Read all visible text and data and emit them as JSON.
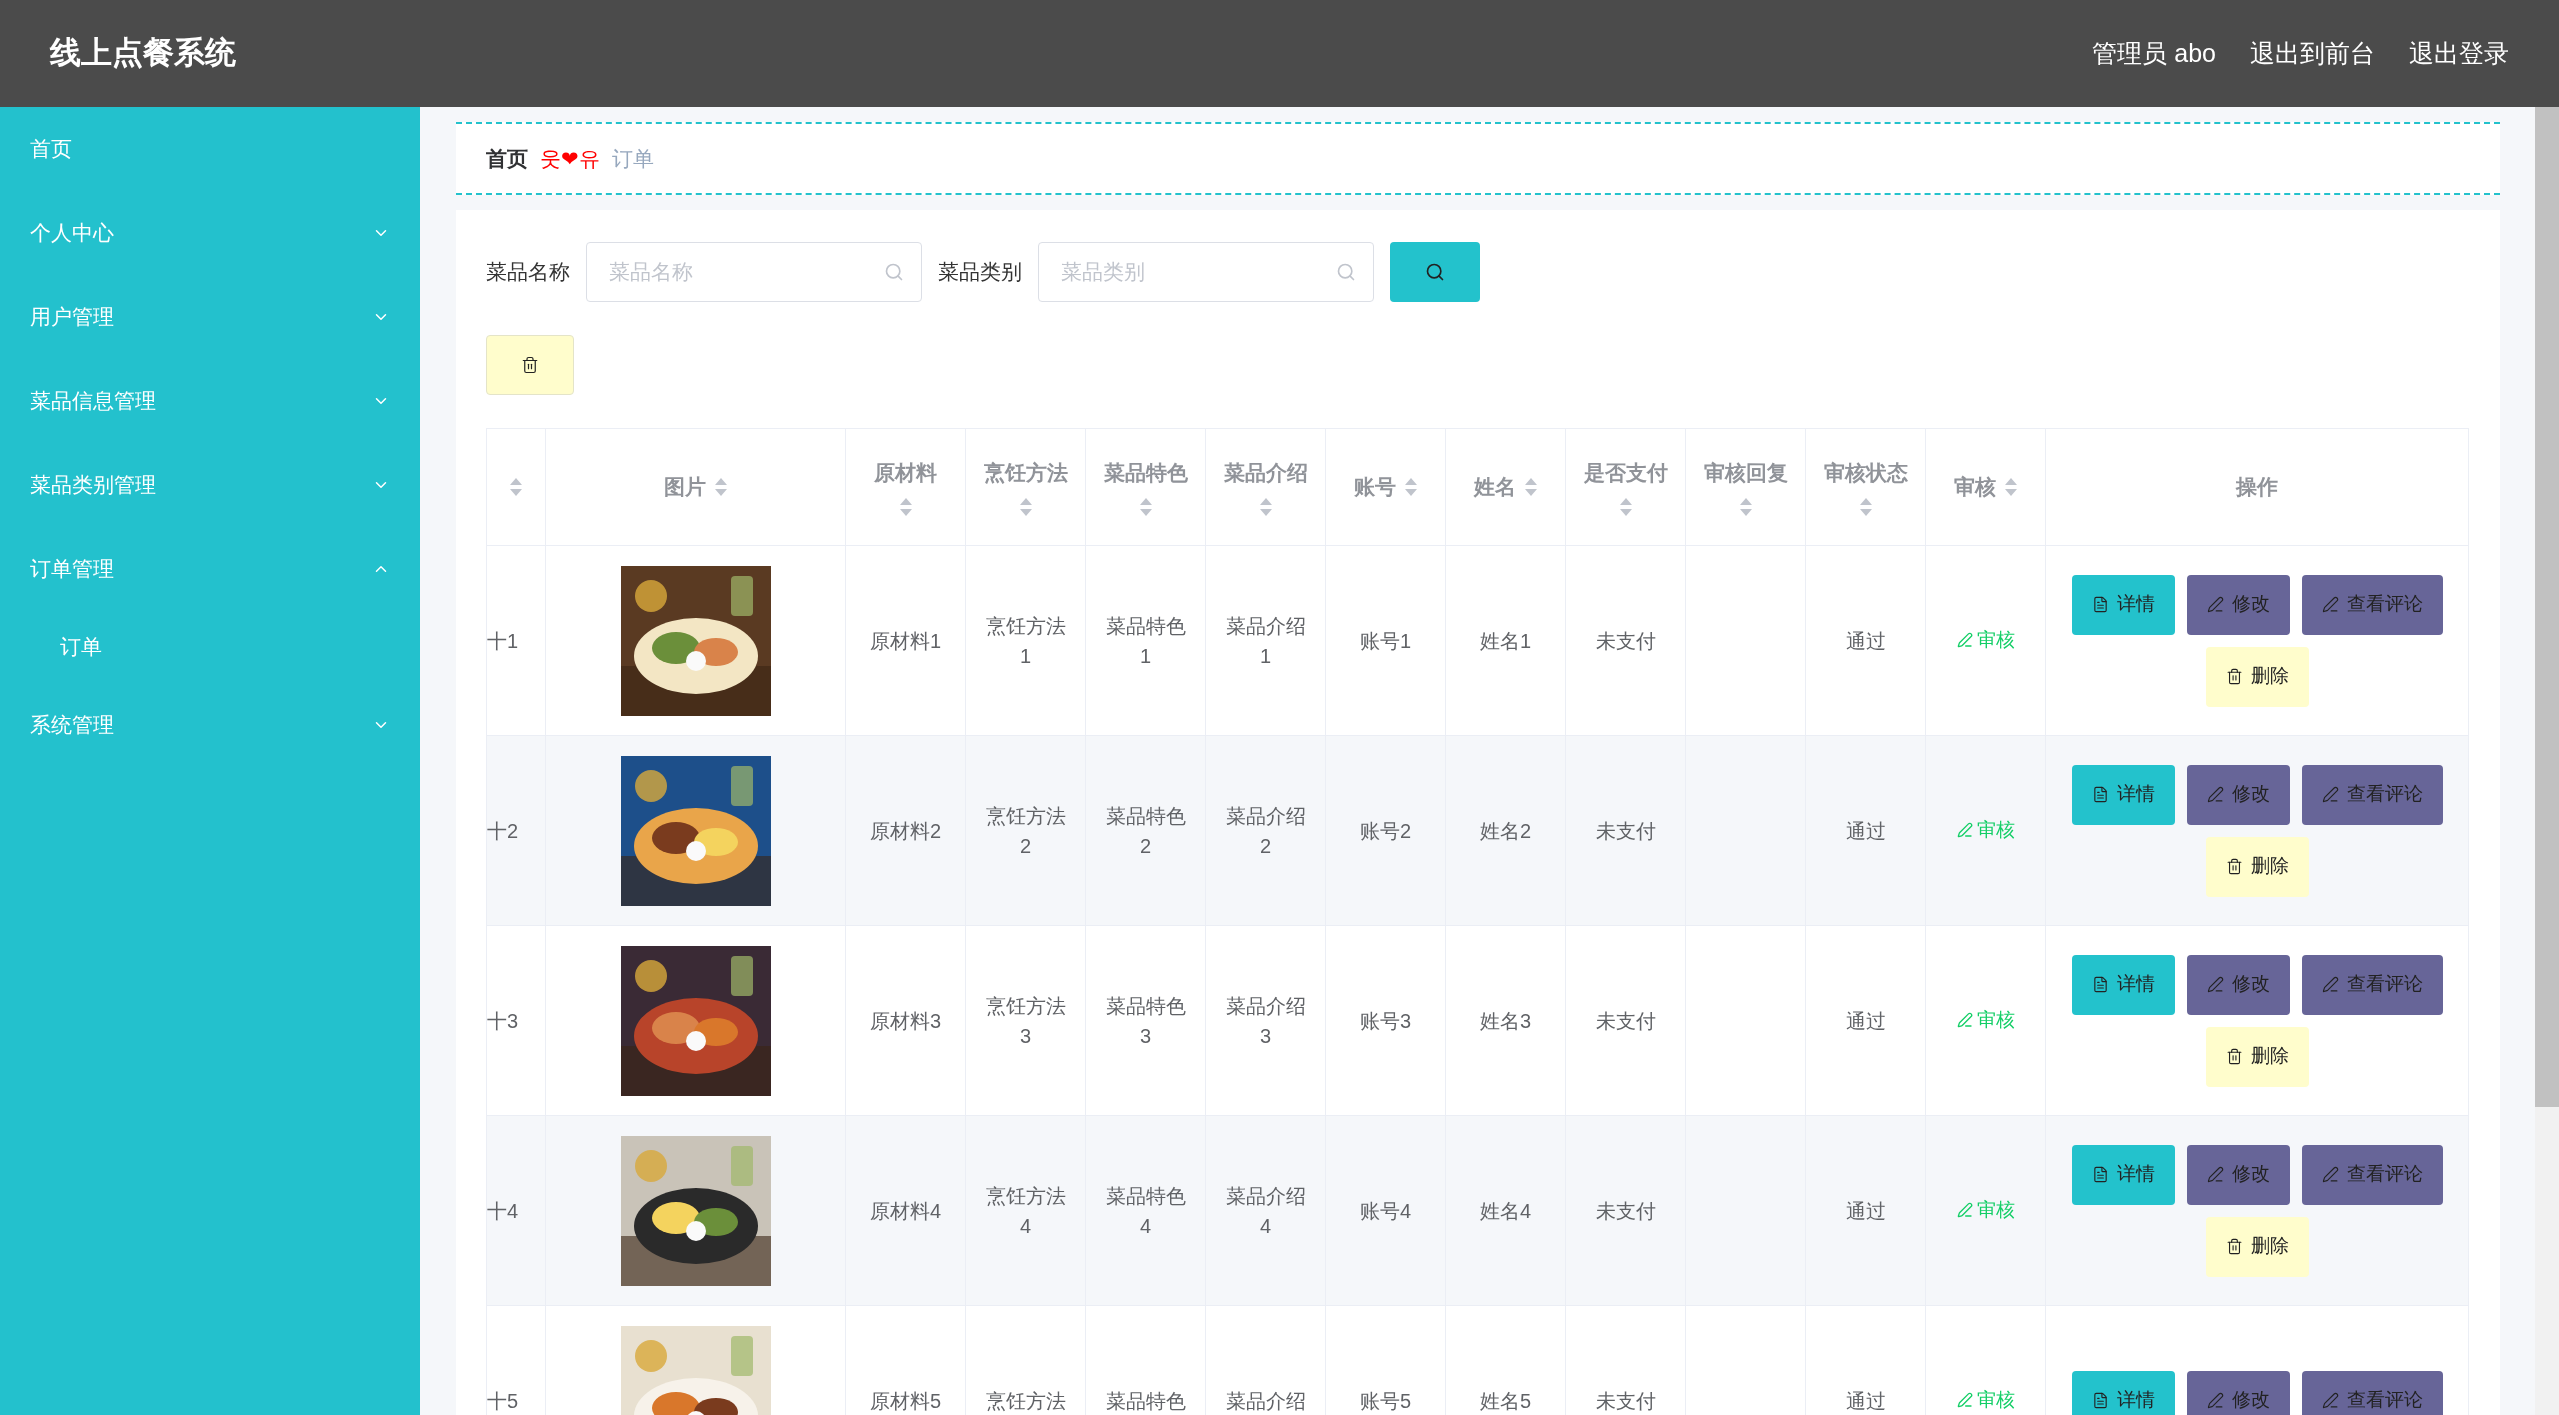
{
  "header": {
    "title": "线上点餐系统",
    "links": [
      "管理员 abo",
      "退出到前台",
      "退出登录"
    ]
  },
  "sidebar": {
    "items": [
      {
        "label": "首页",
        "kind": "link"
      },
      {
        "label": "个人中心",
        "kind": "menu",
        "expanded": false
      },
      {
        "label": "用户管理",
        "kind": "menu",
        "expanded": false
      },
      {
        "label": "菜品信息管理",
        "kind": "menu",
        "expanded": false
      },
      {
        "label": "菜品类别管理",
        "kind": "menu",
        "expanded": false
      },
      {
        "label": "订单管理",
        "kind": "menu",
        "expanded": true,
        "children": [
          {
            "label": "订单"
          }
        ]
      },
      {
        "label": "系统管理",
        "kind": "menu",
        "expanded": false
      }
    ]
  },
  "breadcrumb": {
    "home": "首页",
    "separator": "웃❤유",
    "current": "订单"
  },
  "search": {
    "fields": [
      {
        "label": "菜品名称",
        "placeholder": "菜品名称"
      },
      {
        "label": "菜品类别",
        "placeholder": "菜品类别"
      }
    ]
  },
  "table": {
    "columns": [
      {
        "sortable": true,
        "stacked_sort": false
      },
      {
        "label": "图片",
        "sortable": true,
        "stacked_sort": false
      },
      {
        "label": "原材料",
        "sortable": true,
        "stacked_sort": true
      },
      {
        "label": "烹饪方法",
        "sortable": true,
        "stacked_sort": true
      },
      {
        "label": "菜品特色",
        "sortable": true,
        "stacked_sort": true
      },
      {
        "label": "菜品介绍",
        "sortable": true,
        "stacked_sort": true
      },
      {
        "label": "账号",
        "sortable": true,
        "stacked_sort": false
      },
      {
        "label": "姓名",
        "sortable": true,
        "stacked_sort": false
      },
      {
        "label": "是否支付",
        "sortable": true,
        "stacked_sort": true
      },
      {
        "label": "审核回复",
        "sortable": true,
        "stacked_sort": true
      },
      {
        "label": "审核状态",
        "sortable": true,
        "stacked_sort": true
      },
      {
        "label": "审核",
        "sortable": true,
        "stacked_sort": false
      },
      {
        "label": "操作",
        "sortable": false
      }
    ],
    "rows": [
      {
        "column_1": "十1",
        "image": {
          "kind": "picture"
        },
        "ingredients": "原材料1",
        "method": "烹饪方法1",
        "feature": "菜品特色1",
        "intro": "菜品介绍1",
        "account": "账号1",
        "name": "姓名1",
        "paid": "未支付",
        "review_status": "通过",
        "review_action": "审核",
        "actions": [
          {
            "label": "详情",
            "kind": "detail"
          },
          {
            "label": "修改",
            "kind": "edit"
          },
          {
            "label": "查看评论",
            "kind": "comment"
          },
          {
            "label": "删除",
            "kind": "delete"
          }
        ]
      },
      {
        "column_1": "十2",
        "image": {
          "kind": "picture"
        },
        "ingredients": "原材料2",
        "method": "烹饪方法2",
        "feature": "菜品特色2",
        "intro": "菜品介绍2",
        "account": "账号2",
        "name": "姓名2",
        "paid": "未支付",
        "review_status": "通过",
        "review_action": "审核",
        "actions": [
          {
            "label": "详情",
            "kind": "detail"
          },
          {
            "label": "修改",
            "kind": "edit"
          },
          {
            "label": "查看评论",
            "kind": "comment"
          },
          {
            "label": "删除",
            "kind": "delete"
          }
        ]
      },
      {
        "column_1": "十3",
        "image": {
          "kind": "picture"
        },
        "ingredients": "原材料3",
        "method": "烹饪方法3",
        "feature": "菜品特色3",
        "intro": "菜品介绍3",
        "account": "账号3",
        "name": "姓名3",
        "paid": "未支付",
        "review_status": "通过",
        "review_action": "审核",
        "actions": [
          {
            "label": "详情",
            "kind": "detail"
          },
          {
            "label": "修改",
            "kind": "edit"
          },
          {
            "label": "查看评论",
            "kind": "comment"
          },
          {
            "label": "删除",
            "kind": "delete"
          }
        ]
      },
      {
        "column_1": "十4",
        "image": {
          "kind": "picture"
        },
        "ingredients": "原材料4",
        "method": "烹饪方法4",
        "feature": "菜品特色4",
        "intro": "菜品介绍4",
        "account": "账号4",
        "name": "姓名4",
        "paid": "未支付",
        "review_status": "通过",
        "review_action": "审核",
        "actions": [
          {
            "label": "详情",
            "kind": "detail"
          },
          {
            "label": "修改",
            "kind": "edit"
          },
          {
            "label": "查看评论",
            "kind": "comment"
          },
          {
            "label": "删除",
            "kind": "delete"
          }
        ]
      },
      {
        "column_1": "十5",
        "image": {
          "kind": "picture"
        },
        "ingredients": "原材料5",
        "method": "烹饪方法",
        "feature": "菜品特色",
        "intro": "菜品介绍",
        "account": "账号5",
        "name": "姓名5",
        "paid": "未支付",
        "review_status": "通过",
        "review_action": "审核",
        "actions": [
          {
            "label": "详情",
            "kind": "detail"
          },
          {
            "label": "修改",
            "kind": "edit"
          },
          {
            "label": "查看评论",
            "kind": "comment"
          }
        ]
      }
    ]
  }
}
